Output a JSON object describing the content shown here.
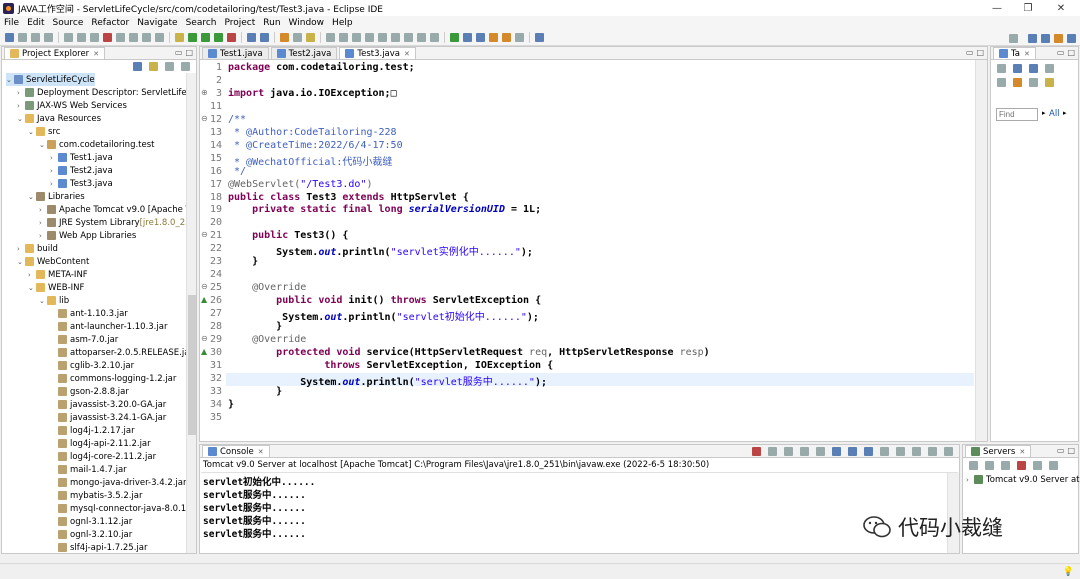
{
  "window": {
    "title": "JAVA工作空间 - ServletLifeCycle/src/com/codetailoring/test/Test3.java - Eclipse IDE",
    "controls": [
      "—",
      "❐",
      "✕"
    ]
  },
  "menu": [
    "File",
    "Edit",
    "Source",
    "Refactor",
    "Navigate",
    "Search",
    "Project",
    "Run",
    "Window",
    "Help"
  ],
  "project_explorer": {
    "tab_label": "Project Explorer",
    "tree": [
      {
        "label": "ServletLifeCycle",
        "icon": "project-icon",
        "depth": 0,
        "arrow": "down",
        "selected": true
      },
      {
        "label": "Deployment Descriptor: ServletLifec",
        "icon": "descriptor-icon",
        "depth": 1,
        "arrow": "right"
      },
      {
        "label": "JAX-WS Web Services",
        "icon": "webservice-icon",
        "depth": 1,
        "arrow": "right"
      },
      {
        "label": "Java Resources",
        "icon": "folder-icon",
        "depth": 1,
        "arrow": "down"
      },
      {
        "label": "src",
        "icon": "folder-icon",
        "depth": 2,
        "arrow": "down"
      },
      {
        "label": "com.codetailoring.test",
        "icon": "package-icon",
        "depth": 3,
        "arrow": "down"
      },
      {
        "label": "Test1.java",
        "icon": "java-file-icon",
        "depth": 4,
        "arrow": "right"
      },
      {
        "label": "Test2.java",
        "icon": "java-file-icon",
        "depth": 4,
        "arrow": "right"
      },
      {
        "label": "Test3.java",
        "icon": "java-file-icon",
        "depth": 4,
        "arrow": "right"
      },
      {
        "label": "Libraries",
        "icon": "library-icon",
        "depth": 2,
        "arrow": "down"
      },
      {
        "label": "Apache Tomcat v9.0 [Apache T",
        "icon": "library-icon",
        "depth": 3,
        "arrow": "right"
      },
      {
        "label": "JRE System Library",
        "suffix": " [jre1.8.0_25",
        "icon": "library-icon",
        "depth": 3,
        "arrow": "right"
      },
      {
        "label": "Web App Libraries",
        "icon": "library-icon",
        "depth": 3,
        "arrow": "right"
      },
      {
        "label": "build",
        "icon": "folder-icon",
        "depth": 1,
        "arrow": "right"
      },
      {
        "label": "WebContent",
        "icon": "folder-icon",
        "depth": 1,
        "arrow": "down"
      },
      {
        "label": "META-INF",
        "icon": "folder-icon",
        "depth": 2,
        "arrow": "right"
      },
      {
        "label": "WEB-INF",
        "icon": "folder-icon",
        "depth": 2,
        "arrow": "down"
      },
      {
        "label": "lib",
        "icon": "folder-icon",
        "depth": 3,
        "arrow": "down"
      },
      {
        "label": "ant-1.10.3.jar",
        "icon": "jar-icon",
        "depth": 4,
        "arrow": ""
      },
      {
        "label": "ant-launcher-1.10.3.jar",
        "icon": "jar-icon",
        "depth": 4,
        "arrow": ""
      },
      {
        "label": "asm-7.0.jar",
        "icon": "jar-icon",
        "depth": 4,
        "arrow": ""
      },
      {
        "label": "attoparser-2.0.5.RELEASE.ja",
        "icon": "jar-icon",
        "depth": 4,
        "arrow": ""
      },
      {
        "label": "cglib-3.2.10.jar",
        "icon": "jar-icon",
        "depth": 4,
        "arrow": ""
      },
      {
        "label": "commons-logging-1.2.jar",
        "icon": "jar-icon",
        "depth": 4,
        "arrow": ""
      },
      {
        "label": "gson-2.8.8.jar",
        "icon": "jar-icon",
        "depth": 4,
        "arrow": ""
      },
      {
        "label": "javassist-3.20.0-GA.jar",
        "icon": "jar-icon",
        "depth": 4,
        "arrow": ""
      },
      {
        "label": "javassist-3.24.1-GA.jar",
        "icon": "jar-icon",
        "depth": 4,
        "arrow": ""
      },
      {
        "label": "log4j-1.2.17.jar",
        "icon": "jar-icon",
        "depth": 4,
        "arrow": ""
      },
      {
        "label": "log4j-api-2.11.2.jar",
        "icon": "jar-icon",
        "depth": 4,
        "arrow": ""
      },
      {
        "label": "log4j-core-2.11.2.jar",
        "icon": "jar-icon",
        "depth": 4,
        "arrow": ""
      },
      {
        "label": "mail-1.4.7.jar",
        "icon": "jar-icon",
        "depth": 4,
        "arrow": ""
      },
      {
        "label": "mongo-java-driver-3.4.2.jar",
        "icon": "jar-icon",
        "depth": 4,
        "arrow": ""
      },
      {
        "label": "mybatis-3.5.2.jar",
        "icon": "jar-icon",
        "depth": 4,
        "arrow": ""
      },
      {
        "label": "mysql-connector-java-8.0.1",
        "icon": "jar-icon",
        "depth": 4,
        "arrow": ""
      },
      {
        "label": "ognl-3.1.12.jar",
        "icon": "jar-icon",
        "depth": 4,
        "arrow": ""
      },
      {
        "label": "ognl-3.2.10.jar",
        "icon": "jar-icon",
        "depth": 4,
        "arrow": ""
      },
      {
        "label": "slf4j-api-1.7.25.jar",
        "icon": "jar-icon",
        "depth": 4,
        "arrow": ""
      }
    ]
  },
  "editor": {
    "tabs": [
      {
        "label": "Test1.java",
        "active": false
      },
      {
        "label": "Test2.java",
        "active": false
      },
      {
        "label": "Test3.java",
        "active": true
      }
    ],
    "highlighted_line": 32,
    "lines": [
      {
        "n": "1",
        "parts": [
          [
            "kw",
            "package "
          ],
          [
            "",
            "com.codetailoring.test;"
          ]
        ]
      },
      {
        "n": "2",
        "parts": []
      },
      {
        "n": "3",
        "marker": "⊕",
        "parts": [
          [
            "kw",
            "import "
          ],
          [
            "",
            "java.io.IOException;"
          ],
          [
            "",
            "□"
          ]
        ]
      },
      {
        "n": "11",
        "parts": []
      },
      {
        "n": "12",
        "marker": "⊖",
        "parts": [
          [
            "cm",
            "/**"
          ]
        ]
      },
      {
        "n": "13",
        "parts": [
          [
            "cm",
            " * @Author:CodeTailoring-228"
          ]
        ]
      },
      {
        "n": "14",
        "parts": [
          [
            "cm",
            " * @CreateTime:2022/6/4-17:50"
          ]
        ]
      },
      {
        "n": "15",
        "parts": [
          [
            "cm",
            " * @WechatOfficial:代码小裁缝"
          ]
        ]
      },
      {
        "n": "16",
        "parts": [
          [
            "cm",
            " */"
          ]
        ]
      },
      {
        "n": "17",
        "parts": [
          [
            "ann",
            "@WebServlet("
          ],
          [
            "str",
            "\"/Test3.do\""
          ],
          [
            "ann",
            ")"
          ]
        ]
      },
      {
        "n": "18",
        "parts": [
          [
            "kw",
            "public class "
          ],
          [
            "",
            "Test3 "
          ],
          [
            "kw",
            "extends "
          ],
          [
            "",
            "HttpServlet {"
          ]
        ]
      },
      {
        "n": "19",
        "parts": [
          [
            "",
            "    "
          ],
          [
            "kw",
            "private static final long "
          ],
          [
            "fld",
            "serialVersionUID"
          ],
          [
            "",
            " = 1L;"
          ]
        ]
      },
      {
        "n": "20",
        "parts": []
      },
      {
        "n": "21",
        "marker": "⊖",
        "parts": [
          [
            "",
            "    "
          ],
          [
            "kw",
            "public "
          ],
          [
            "",
            "Test3() {"
          ]
        ]
      },
      {
        "n": "22",
        "parts": [
          [
            "",
            "        System."
          ],
          [
            "fld",
            "out"
          ],
          [
            "",
            ".println("
          ],
          [
            "str",
            "\"servlet实例化中......\""
          ],
          [
            "",
            ");"
          ]
        ]
      },
      {
        "n": "23",
        "parts": [
          [
            "",
            "    }"
          ]
        ]
      },
      {
        "n": "24",
        "parts": []
      },
      {
        "n": "25",
        "marker": "⊖",
        "parts": [
          [
            "",
            "    "
          ],
          [
            "ann",
            "@Override"
          ]
        ]
      },
      {
        "n": "26",
        "marker": "▲",
        "parts": [
          [
            "",
            "        "
          ],
          [
            "kw",
            "public void "
          ],
          [
            "",
            "init() "
          ],
          [
            "kw",
            "throws "
          ],
          [
            "",
            "ServletException {"
          ]
        ]
      },
      {
        "n": "27",
        "parts": [
          [
            "",
            "         System."
          ],
          [
            "fld",
            "out"
          ],
          [
            "",
            ".println("
          ],
          [
            "str",
            "\"servlet初始化中......\""
          ],
          [
            "",
            ");"
          ]
        ]
      },
      {
        "n": "28",
        "parts": [
          [
            "",
            "        }"
          ]
        ]
      },
      {
        "n": "29",
        "marker": "⊖",
        "parts": [
          [
            "",
            "    "
          ],
          [
            "ann",
            "@Override"
          ]
        ]
      },
      {
        "n": "30",
        "marker": "▲",
        "parts": [
          [
            "",
            "        "
          ],
          [
            "kw",
            "protected void "
          ],
          [
            "",
            "service(HttpServletRequest "
          ],
          [
            "ann",
            "req"
          ],
          [
            "",
            ", HttpServletResponse "
          ],
          [
            "ann",
            "resp"
          ],
          [
            "",
            ")"
          ]
        ]
      },
      {
        "n": "31",
        "parts": [
          [
            "",
            "                "
          ],
          [
            "kw",
            "throws "
          ],
          [
            "",
            "ServletException, IOException {"
          ]
        ]
      },
      {
        "n": "32",
        "parts": [
          [
            "",
            "            System."
          ],
          [
            "fld",
            "out"
          ],
          [
            "",
            ".println("
          ],
          [
            "str",
            "\"servlet服务中......\""
          ],
          [
            "",
            ");"
          ]
        ]
      },
      {
        "n": "33",
        "parts": [
          [
            "",
            "        }"
          ]
        ]
      },
      {
        "n": "34",
        "parts": [
          [
            "",
            "}"
          ]
        ]
      },
      {
        "n": "35",
        "parts": []
      }
    ]
  },
  "outline": {
    "tab_label": "Ta",
    "find_placeholder": "Find",
    "all_label": "All"
  },
  "console": {
    "tab_label": "Console",
    "header": "Tomcat v9.0 Server at localhost [Apache Tomcat] C:\\Program Files\\Java\\jre1.8.0_251\\bin\\javaw.exe  (2022-6-5 18:30:50)",
    "output": [
      "servlet初始化中......",
      "servlet服务中......",
      "servlet服务中......",
      "servlet服务中......",
      "servlet服务中......"
    ]
  },
  "servers": {
    "tab_label": "Servers",
    "items": [
      "Tomcat v9.0 Server at"
    ]
  },
  "watermark": "代码小裁缝"
}
